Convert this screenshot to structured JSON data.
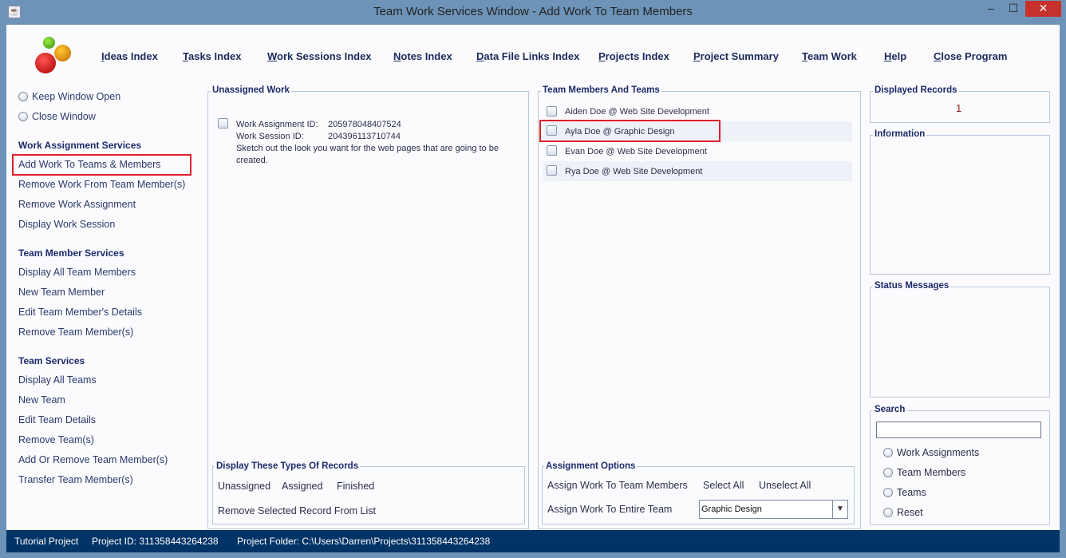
{
  "window": {
    "title": "Team Work Services Window - Add Work To Team Members",
    "minimize": "–",
    "maximize": "☐",
    "close": "✕"
  },
  "nav": [
    "Ideas Index",
    "Tasks Index",
    "Work Sessions Index",
    "Notes Index",
    "Data File Links Index",
    "Projects Index",
    "Project Summary",
    "Team Work",
    "Help",
    "Close Program"
  ],
  "sidebar": {
    "keep_open": "Keep Window Open",
    "close_window": "Close Window",
    "work_heading": "Work Assignment Services",
    "work_items": [
      "Add Work To Teams & Members",
      "Remove Work From Team Member(s)",
      "Remove Work Assignment",
      "Display Work Session"
    ],
    "member_heading": "Team Member Services",
    "member_items": [
      "Display All Team Members",
      "New Team Member",
      "Edit Team Member's Details",
      "Remove Team Member(s)"
    ],
    "team_heading": "Team Services",
    "team_items": [
      "Display All Teams",
      "New Team",
      "Edit Team Details",
      "Remove Team(s)",
      "Add Or Remove Team Member(s)",
      "Transfer Team Member(s)"
    ]
  },
  "unassigned": {
    "title": "Unassigned Work",
    "record": {
      "assign_label": "Work Assignment ID:",
      "assign_id": "205978048407524",
      "session_label": "Work Session ID:",
      "session_id": "204396113710744",
      "desc1": "Sketch out the look you want for the web pages that are going to be",
      "desc2": "created."
    }
  },
  "display_types": {
    "title": "Display These Types Of Records",
    "unassigned": "Unassigned",
    "assigned": "Assigned",
    "finished": "Finished",
    "remove": "Remove Selected Record From List"
  },
  "members": {
    "title": "Team Members And Teams",
    "items": [
      "Aiden Doe @ Web Site Development",
      "Ayla Doe @ Graphic Design",
      "Evan Doe @ Web Site Development",
      "Rya Doe @ Web Site Development"
    ]
  },
  "assignment": {
    "title": "Assignment Options",
    "assign_members": "Assign Work To Team Members",
    "select_all": "Select All",
    "unselect_all": "Unselect All",
    "assign_team": "Assign Work To Entire Team",
    "team_selected": "Graphic Design"
  },
  "displayed": {
    "title": "Displayed Records",
    "count": "1"
  },
  "information": {
    "title": "Information"
  },
  "status_messages": {
    "title": "Status Messages"
  },
  "search": {
    "title": "Search",
    "value": "",
    "options": [
      "Work Assignments",
      "Team Members",
      "Teams",
      "Reset"
    ]
  },
  "statusbar": {
    "project": "Tutorial Project",
    "project_id": "Project ID:  311358443264238",
    "folder": "Project Folder: C:\\Users\\Darren\\Projects\\311358443264238"
  }
}
